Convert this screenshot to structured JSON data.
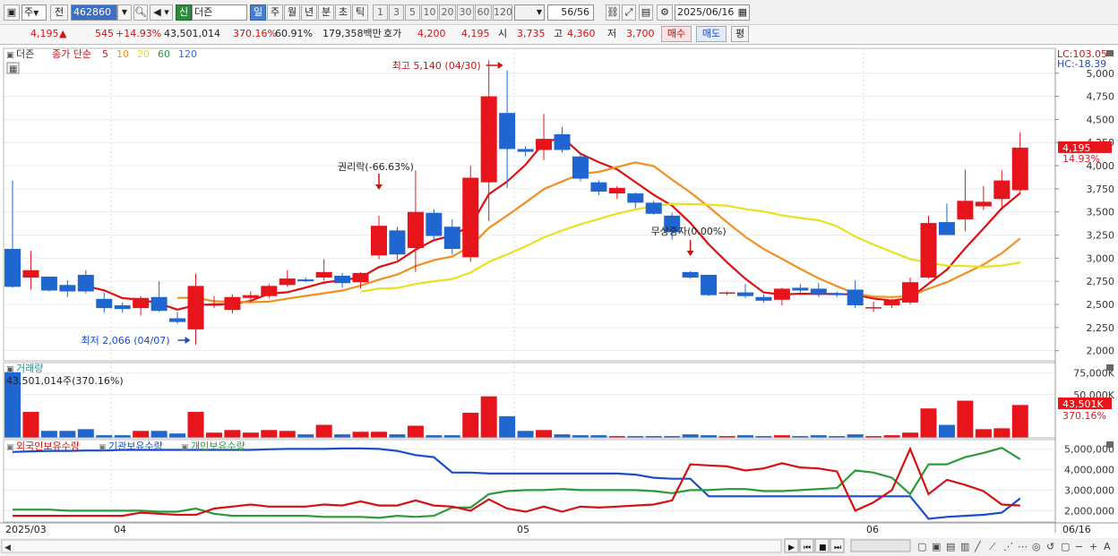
{
  "toolbar": {
    "type_select": "주",
    "prev_label": "전",
    "code_value": "462860",
    "new_label": "신",
    "name_value": "더즌",
    "periods": [
      "일",
      "주",
      "월",
      "년",
      "분",
      "초",
      "틱"
    ],
    "period_selected": "일",
    "nums": [
      "1",
      "3",
      "5",
      "10",
      "20",
      "30",
      "60",
      "120"
    ],
    "count_value": "56/56",
    "date_value": "2025/06/16"
  },
  "quote": {
    "price": "4,195",
    "arrow": "▲",
    "change": "545",
    "change_pct": "+14.93%",
    "volume": "43,501,014",
    "vol_ratio": "370.16%",
    "turnover": "60.91%",
    "amount": "179,358백만",
    "hoga_label": "호가",
    "hoga1": "4,200",
    "hoga2": "4,195",
    "open_label": "시",
    "open": "3,735",
    "high_label": "고",
    "high": "4,360",
    "low_label": "저",
    "low": "3,700",
    "buy_label": "매수",
    "sell_label": "매도",
    "flat_label": "평"
  },
  "legend": {
    "name": "더즌",
    "series_label": "종가 단순",
    "ma": [
      "5",
      "10",
      "20",
      "60",
      "120"
    ],
    "ma_colors": [
      "#dd1010",
      "#f09020",
      "#e8e020",
      "#2a9a3a",
      "#3a6ad0"
    ]
  },
  "right_info": {
    "lc": "LC:103.05",
    "hc": "HC:-18.39",
    "price_tag": "4,195",
    "pct_tag": "14.93%"
  },
  "annotations": {
    "high": "최고 5,140 (04/30)",
    "low": "최저 2,066 (04/07)",
    "rights": "권리락(-66.63%)",
    "bonus": "무상증자(0.00%)"
  },
  "volume_panel": {
    "title": "거래량",
    "value_text": "43,501,014주(370.16%)",
    "axis_labels": [
      "75,000K",
      "50,000K"
    ],
    "tag_value": "43,501K",
    "tag_pct": "370.16%"
  },
  "holdings_panel": {
    "series": [
      "외국인보유수량",
      "기관보유수량",
      "개인보유수량"
    ],
    "series_colors": [
      "#d61111",
      "#1a4ec8",
      "#2a9a3a"
    ],
    "axis_labels": [
      "5,000,000",
      "4,000,000",
      "3,000,000",
      "2,000,000"
    ]
  },
  "x_labels": [
    "2025/03",
    "04",
    "05",
    "06",
    "06/16"
  ],
  "colors": {
    "up": "#e8141c",
    "down": "#1f66d1"
  },
  "chart_data": {
    "type": "candlestick",
    "y_ticks": [
      5000,
      4750,
      4500,
      4250,
      4000,
      3750,
      3500,
      3250,
      3000,
      2750,
      2500,
      2250,
      2000
    ],
    "ylim": [
      1890,
      5230
    ],
    "candles": [
      {
        "o": 3100,
        "h": 3840,
        "l": 2680,
        "c": 2690
      },
      {
        "o": 2790,
        "h": 3080,
        "l": 2660,
        "c": 2870
      },
      {
        "o": 2800,
        "h": 2800,
        "l": 2640,
        "c": 2650
      },
      {
        "o": 2710,
        "h": 2760,
        "l": 2580,
        "c": 2640
      },
      {
        "o": 2820,
        "h": 2870,
        "l": 2620,
        "c": 2640
      },
      {
        "o": 2560,
        "h": 2630,
        "l": 2410,
        "c": 2460
      },
      {
        "o": 2490,
        "h": 2520,
        "l": 2410,
        "c": 2450
      },
      {
        "o": 2460,
        "h": 2590,
        "l": 2380,
        "c": 2570
      },
      {
        "o": 2580,
        "h": 2750,
        "l": 2420,
        "c": 2430
      },
      {
        "o": 2350,
        "h": 2420,
        "l": 2290,
        "c": 2310
      },
      {
        "o": 2230,
        "h": 2830,
        "l": 2066,
        "c": 2700
      },
      {
        "o": 2500,
        "h": 2590,
        "l": 2460,
        "c": 2500
      },
      {
        "o": 2440,
        "h": 2610,
        "l": 2400,
        "c": 2580
      },
      {
        "o": 2570,
        "h": 2640,
        "l": 2520,
        "c": 2600
      },
      {
        "o": 2590,
        "h": 2720,
        "l": 2570,
        "c": 2700
      },
      {
        "o": 2710,
        "h": 2870,
        "l": 2690,
        "c": 2780
      },
      {
        "o": 2770,
        "h": 2790,
        "l": 2740,
        "c": 2750
      },
      {
        "o": 2790,
        "h": 2990,
        "l": 2760,
        "c": 2850
      },
      {
        "o": 2810,
        "h": 2840,
        "l": 2680,
        "c": 2730
      },
      {
        "o": 2740,
        "h": 2850,
        "l": 2670,
        "c": 2840
      },
      {
        "o": 3030,
        "h": 3460,
        "l": 2990,
        "c": 3350
      },
      {
        "o": 3300,
        "h": 3340,
        "l": 2980,
        "c": 3040
      },
      {
        "o": 3110,
        "h": 3950,
        "l": 2850,
        "c": 3500
      },
      {
        "o": 3490,
        "h": 3530,
        "l": 3200,
        "c": 3240
      },
      {
        "o": 3340,
        "h": 3420,
        "l": 3040,
        "c": 3100
      },
      {
        "o": 3010,
        "h": 4000,
        "l": 2960,
        "c": 3870
      },
      {
        "o": 3820,
        "h": 5140,
        "l": 3400,
        "c": 4750
      },
      {
        "o": 4570,
        "h": 5030,
        "l": 3760,
        "c": 4180
      },
      {
        "o": 4180,
        "h": 4210,
        "l": 4100,
        "c": 4150
      },
      {
        "o": 4170,
        "h": 4560,
        "l": 4060,
        "c": 4290
      },
      {
        "o": 4340,
        "h": 4420,
        "l": 4140,
        "c": 4170
      },
      {
        "o": 4100,
        "h": 4130,
        "l": 3830,
        "c": 3860
      },
      {
        "o": 3820,
        "h": 3840,
        "l": 3680,
        "c": 3720
      },
      {
        "o": 3700,
        "h": 3780,
        "l": 3640,
        "c": 3760
      },
      {
        "o": 3700,
        "h": 3710,
        "l": 3540,
        "c": 3600
      },
      {
        "o": 3600,
        "h": 3620,
        "l": 3470,
        "c": 3480
      },
      {
        "o": 3460,
        "h": 3490,
        "l": 3200,
        "c": 3280
      },
      {
        "o": 2850,
        "h": 2860,
        "l": 2780,
        "c": 2790
      },
      {
        "o": 2820,
        "h": 2820,
        "l": 2590,
        "c": 2600
      },
      {
        "o": 2620,
        "h": 2640,
        "l": 2600,
        "c": 2630
      },
      {
        "o": 2630,
        "h": 2720,
        "l": 2570,
        "c": 2590
      },
      {
        "o": 2580,
        "h": 2610,
        "l": 2520,
        "c": 2540
      },
      {
        "o": 2550,
        "h": 2680,
        "l": 2490,
        "c": 2670
      },
      {
        "o": 2680,
        "h": 2720,
        "l": 2630,
        "c": 2650
      },
      {
        "o": 2670,
        "h": 2730,
        "l": 2580,
        "c": 2610
      },
      {
        "o": 2620,
        "h": 2640,
        "l": 2580,
        "c": 2600
      },
      {
        "o": 2660,
        "h": 2760,
        "l": 2460,
        "c": 2490
      },
      {
        "o": 2470,
        "h": 2530,
        "l": 2420,
        "c": 2470
      },
      {
        "o": 2490,
        "h": 2560,
        "l": 2460,
        "c": 2540
      },
      {
        "o": 2520,
        "h": 2790,
        "l": 2500,
        "c": 2740
      },
      {
        "o": 2790,
        "h": 3460,
        "l": 2780,
        "c": 3380
      },
      {
        "o": 3390,
        "h": 3590,
        "l": 3300,
        "c": 3250
      },
      {
        "o": 3420,
        "h": 3960,
        "l": 3290,
        "c": 3620
      },
      {
        "o": 3560,
        "h": 3780,
        "l": 3520,
        "c": 3610
      },
      {
        "o": 3640,
        "h": 3950,
        "l": 3520,
        "c": 3840
      },
      {
        "o": 3735,
        "h": 4360,
        "l": 3700,
        "c": 4195
      }
    ],
    "volumes": [
      76,
      30,
      8,
      8,
      10,
      3,
      3,
      8,
      8,
      5,
      30,
      6,
      9,
      6,
      9,
      8,
      4,
      15,
      4,
      7,
      7,
      4,
      14,
      3,
      3,
      29,
      48,
      25,
      8,
      9,
      4,
      3,
      3,
      2,
      2,
      2,
      2,
      4,
      3,
      2,
      3,
      2,
      3,
      2,
      3,
      2,
      4,
      2,
      3,
      6,
      34,
      15,
      43,
      10,
      11,
      38
    ],
    "foreign_holdings": [
      1.75,
      1.75,
      1.75,
      1.75,
      1.75,
      1.75,
      1.75,
      1.9,
      1.85,
      1.8,
      1.8,
      2.1,
      2.2,
      2.3,
      2.2,
      2.2,
      2.2,
      2.3,
      2.25,
      2.45,
      2.25,
      2.25,
      2.5,
      2.25,
      2.2,
      2.0,
      2.55,
      2.1,
      1.95,
      2.2,
      1.95,
      2.2,
      2.15,
      2.2,
      2.25,
      2.3,
      2.5,
      4.25,
      4.2,
      4.15,
      3.95,
      4.05,
      4.3,
      4.1,
      4.05,
      3.9,
      2.0,
      2.4,
      3.0,
      5.0,
      2.8,
      3.5,
      3.25,
      2.95,
      2.3,
      2.25
    ],
    "institution_holdings": [
      4.85,
      4.88,
      4.9,
      4.9,
      4.92,
      4.92,
      4.95,
      4.95,
      4.95,
      4.95,
      4.95,
      4.95,
      4.95,
      4.95,
      4.98,
      5.0,
      5.0,
      5.0,
      5.02,
      5.02,
      5.0,
      4.9,
      4.7,
      4.6,
      3.85,
      3.85,
      3.8,
      3.8,
      3.8,
      3.8,
      3.8,
      3.8,
      3.8,
      3.8,
      3.75,
      3.6,
      3.55,
      3.55,
      2.7,
      2.7,
      2.7,
      2.7,
      2.7,
      2.7,
      2.7,
      2.7,
      2.7,
      2.7,
      2.7,
      2.7,
      1.6,
      1.7,
      1.75,
      1.8,
      1.9,
      2.6
    ],
    "individual_holdings": [
      2.05,
      2.05,
      2.05,
      2.0,
      2.0,
      2.0,
      2.0,
      2.0,
      1.95,
      1.95,
      2.1,
      1.85,
      1.75,
      1.75,
      1.75,
      1.75,
      1.75,
      1.7,
      1.7,
      1.7,
      1.65,
      1.75,
      1.7,
      1.75,
      2.15,
      2.15,
      2.8,
      2.95,
      3.0,
      3.0,
      3.05,
      3.0,
      3.0,
      3.0,
      3.0,
      2.95,
      2.85,
      3.0,
      3.0,
      3.05,
      3.05,
      2.95,
      2.95,
      3.0,
      3.05,
      3.1,
      3.95,
      3.85,
      3.6,
      2.8,
      4.25,
      4.25,
      4.6,
      4.8,
      5.05,
      4.5
    ]
  }
}
